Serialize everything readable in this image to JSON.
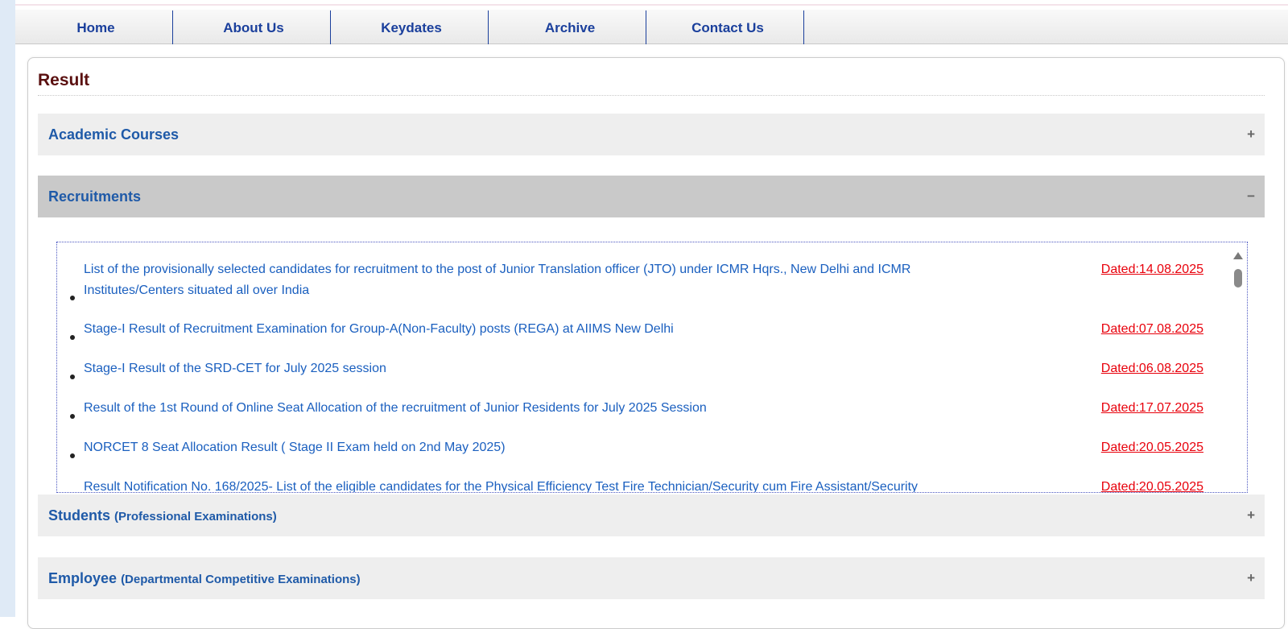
{
  "nav": {
    "items": [
      {
        "label": "Home"
      },
      {
        "label": "About Us"
      },
      {
        "label": "Keydates"
      },
      {
        "label": "Archive"
      },
      {
        "label": "Contact Us"
      }
    ]
  },
  "page": {
    "title": "Result"
  },
  "accordion": {
    "academic": {
      "label": "Academic Courses",
      "toggle": "+"
    },
    "recruitments": {
      "label": "Recruitments",
      "toggle": "−"
    },
    "students": {
      "label": "Students",
      "sublabel": "(Professional Examinations)",
      "toggle": "+"
    },
    "employee": {
      "label": "Employee",
      "sublabel": "(Departmental Competitive Examinations)",
      "toggle": "+"
    }
  },
  "recruitment_results": [
    {
      "text": "List of the provisionally selected candidates for recruitment to the post of Junior Translation officer (JTO) under ICMR Hqrs., New Delhi and ICMR Institutes/Centers situated all over India",
      "date": "Dated:14.08.2025"
    },
    {
      "text": "Stage-I Result of Recruitment Examination for Group-A(Non-Faculty) posts (REGA) at AIIMS New Delhi",
      "date": "Dated:07.08.2025"
    },
    {
      "text": "Stage-I Result of the SRD-CET for July 2025 session",
      "date": "Dated:06.08.2025"
    },
    {
      "text": "Result of the 1st Round of Online Seat Allocation of the recruitment of Junior Residents for July 2025 Session",
      "date": "Dated:17.07.2025"
    },
    {
      "text": "NORCET 8 Seat Allocation Result ( Stage II Exam held on 2nd May 2025)",
      "date": "Dated:20.05.2025"
    },
    {
      "text": "Result Notification No. 168/2025- List of the eligible candidates for the Physical Efficiency Test  Fire Technician/Security cum Fire Assistant/Security",
      "date": "Dated:20.05.2025"
    }
  ]
}
